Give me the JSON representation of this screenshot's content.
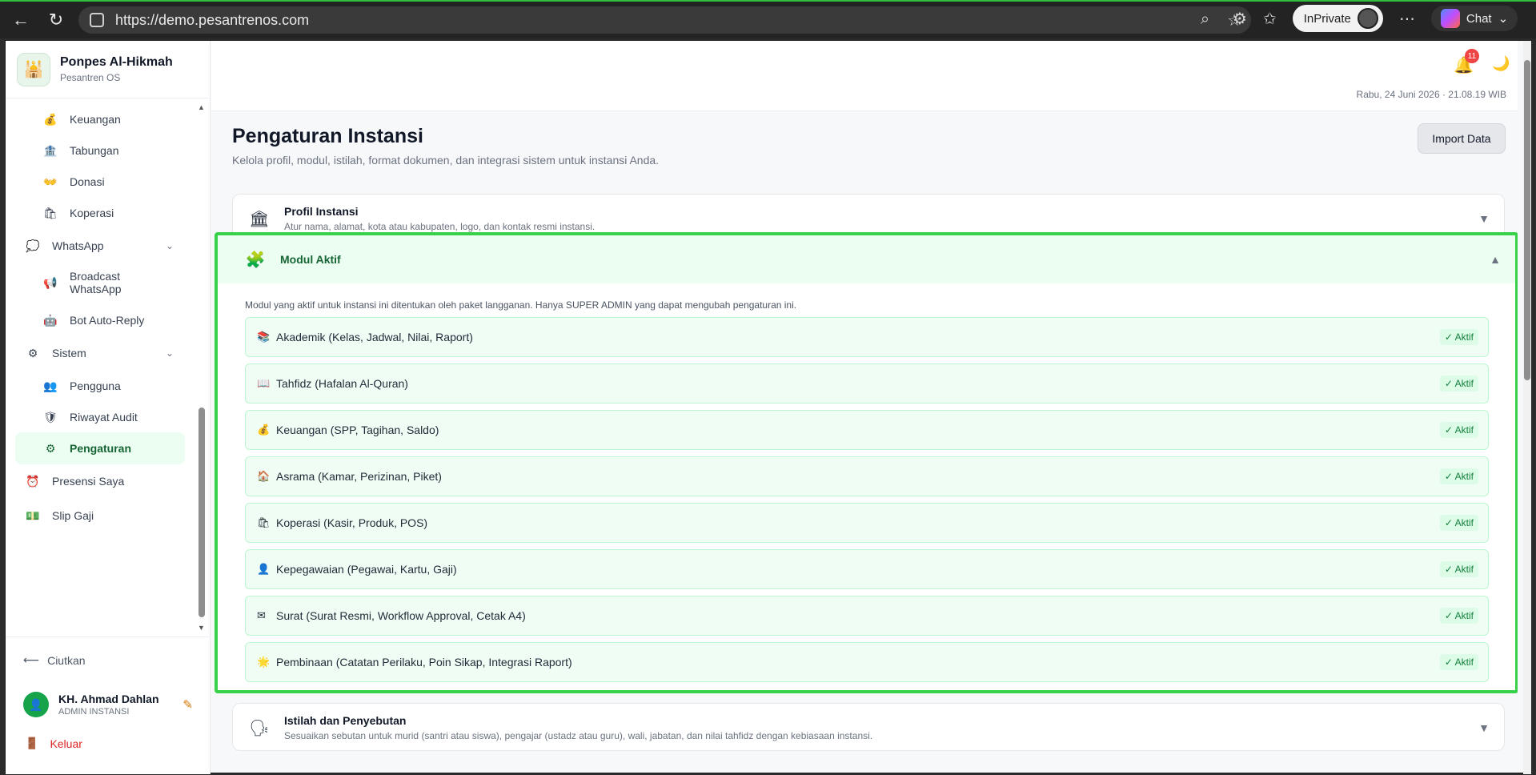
{
  "browser": {
    "url": "https://demo.pesantrenos.com",
    "inprivate_label": "InPrivate",
    "chat_label": "Chat"
  },
  "brand": {
    "name": "Ponpes Al-Hikmah",
    "subtitle": "Pesantren OS"
  },
  "sidebar": {
    "items": [
      {
        "label": "Keuangan",
        "icon": "💰"
      },
      {
        "label": "Tabungan",
        "icon": "🏦"
      },
      {
        "label": "Donasi",
        "icon": "👐"
      },
      {
        "label": "Koperasi",
        "icon": "🛍"
      },
      {
        "label": "WhatsApp",
        "icon": "💭"
      },
      {
        "label": "Broadcast WhatsApp",
        "icon": "📢"
      },
      {
        "label": "Bot Auto-Reply",
        "icon": "🤖"
      },
      {
        "label": "Sistem",
        "icon": "⚙"
      },
      {
        "label": "Pengguna",
        "icon": "👥"
      },
      {
        "label": "Riwayat Audit",
        "icon": "🛡"
      },
      {
        "label": "Pengaturan",
        "icon": "⚙"
      },
      {
        "label": "Presensi Saya",
        "icon": "⏰"
      },
      {
        "label": "Slip Gaji",
        "icon": "💵"
      }
    ],
    "collapse_label": "Ciutkan",
    "user_name": "KH. Ahmad Dahlan",
    "user_role": "ADMIN INSTANSI",
    "logout_label": "Keluar"
  },
  "topbar": {
    "notification_count": "11",
    "datetime": "Rabu, 24 Juni 2026 · 21.08.19 WIB"
  },
  "page": {
    "title": "Pengaturan Instansi",
    "subtitle": "Kelola profil, modul, istilah, format dokumen, dan integrasi sistem untuk instansi Anda.",
    "import_label": "Import Data"
  },
  "profil": {
    "title": "Profil Instansi",
    "desc": "Atur nama, alamat, kota atau kabupaten, logo, dan kontak resmi instansi."
  },
  "modul": {
    "title": "Modul Aktif",
    "note": "Modul yang aktif untuk instansi ini ditentukan oleh paket langganan. Hanya SUPER ADMIN yang dapat mengubah pengaturan ini.",
    "items": [
      {
        "icon": "📚",
        "label": "Akademik (Kelas, Jadwal, Nilai, Raport)",
        "status": "✓ Aktif"
      },
      {
        "icon": "📖",
        "label": "Tahfidz (Hafalan Al-Quran)",
        "status": "✓ Aktif"
      },
      {
        "icon": "💰",
        "label": "Keuangan (SPP, Tagihan, Saldo)",
        "status": "✓ Aktif"
      },
      {
        "icon": "🏠",
        "label": "Asrama (Kamar, Perizinan, Piket)",
        "status": "✓ Aktif"
      },
      {
        "icon": "🛍",
        "label": "Koperasi (Kasir, Produk, POS)",
        "status": "✓ Aktif"
      },
      {
        "icon": "👤",
        "label": "Kepegawaian (Pegawai, Kartu, Gaji)",
        "status": "✓ Aktif"
      },
      {
        "icon": "✉",
        "label": "Surat (Surat Resmi, Workflow Approval, Cetak A4)",
        "status": "✓ Aktif"
      },
      {
        "icon": "🌟",
        "label": "Pembinaan (Catatan Perilaku, Poin Sikap, Integrasi Raport)",
        "status": "✓ Aktif"
      }
    ]
  },
  "istilah": {
    "title": "Istilah dan Penyebutan",
    "desc": "Sesuaikan sebutan untuk murid (santri atau siswa), pengajar (ustadz atau guru), wali, jabatan, dan nilai tahfidz dengan kebiasaan instansi."
  }
}
